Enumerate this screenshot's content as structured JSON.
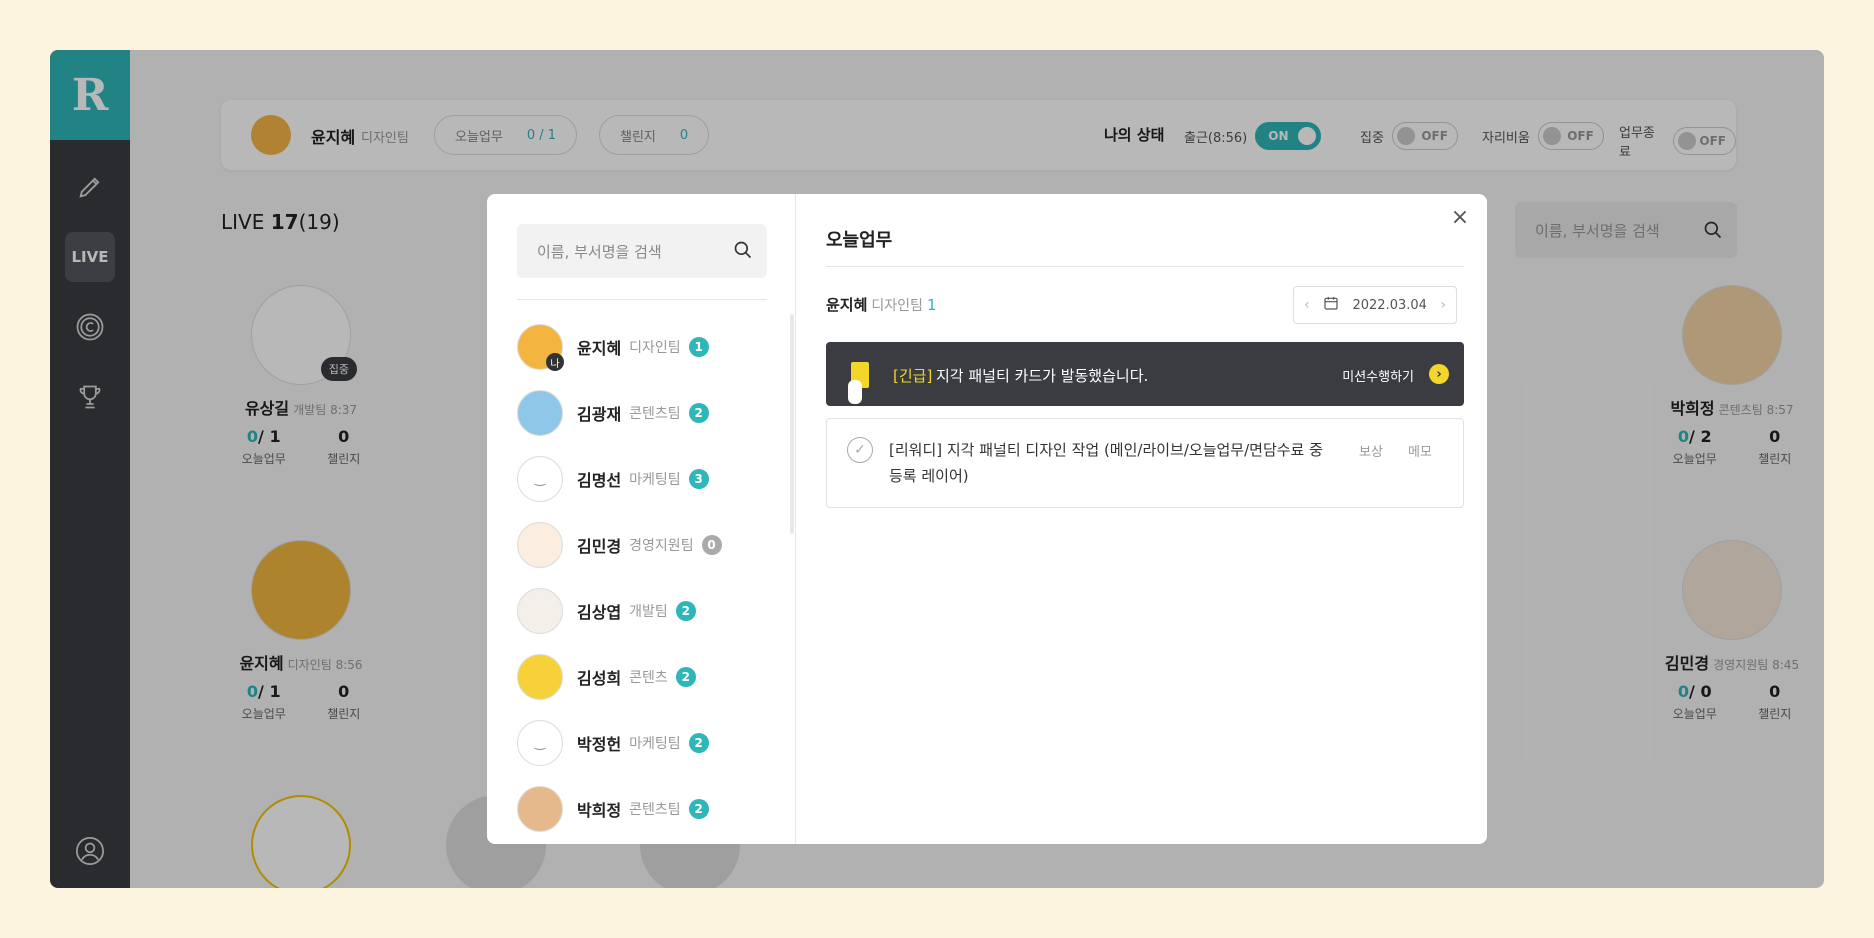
{
  "sidebar": {
    "logo": "R",
    "live_label": "LIVE"
  },
  "topbar": {
    "name": "윤지혜",
    "team": "디자인팀",
    "today_label": "오늘업무",
    "today_value": "0 / 1",
    "challenge_label": "챌린지",
    "challenge_value": "0",
    "status_label": "나의 상태",
    "toggles": [
      {
        "label": "출근(8:56)",
        "state": "ON"
      },
      {
        "label": "집중",
        "state": "OFF"
      },
      {
        "label": "자리비움",
        "state": "OFF"
      },
      {
        "label": "업무종료",
        "state": "OFF"
      }
    ]
  },
  "live": {
    "title_prefix": "LIVE",
    "count": "17",
    "total": "(19)",
    "search_placeholder": "이름, 부서명을 검색"
  },
  "cards": [
    {
      "name": "유상길",
      "team": "개발팀",
      "time": "8:37",
      "today": "0",
      "today_total": "/ 1",
      "challenge": "0",
      "badge": "집중"
    },
    {
      "name": "박희정",
      "team": "콘텐츠팀",
      "time": "8:57",
      "today": "0",
      "today_total": "/ 2",
      "challenge": "0"
    },
    {
      "name": "윤지혜",
      "team": "디자인팀",
      "time": "8:56",
      "today": "0",
      "today_total": "/ 1",
      "challenge": "0"
    },
    {
      "name": "김민경",
      "team": "경영지원팀",
      "time": "8:45",
      "today": "0",
      "today_total": "/ 0",
      "challenge": "0"
    }
  ],
  "card_labels": {
    "today": "오늘업무",
    "challenge": "챌린지"
  },
  "modal": {
    "search_placeholder": "이름, 부서명을 검색",
    "members": [
      {
        "name": "윤지혜",
        "team": "디자인팀",
        "count": "1",
        "me": "나"
      },
      {
        "name": "김광재",
        "team": "콘텐츠팀",
        "count": "2"
      },
      {
        "name": "김명선",
        "team": "마케팅팀",
        "count": "3"
      },
      {
        "name": "김민경",
        "team": "경영지원팀",
        "count": "0"
      },
      {
        "name": "김상엽",
        "team": "개발팀",
        "count": "2"
      },
      {
        "name": "김성희",
        "team": "콘텐츠",
        "count": "2"
      },
      {
        "name": "박정헌",
        "team": "마케팅팀",
        "count": "2"
      },
      {
        "name": "박희정",
        "team": "콘텐츠팀",
        "count": "2"
      }
    ],
    "title": "오늘업무",
    "user_name": "윤지혜",
    "user_team": "디자인팀",
    "user_count": "1",
    "date": "2022.03.04",
    "alert_tag": "[긴급]",
    "alert_msg": "지각 패널티 카드가 발동했습니다.",
    "alert_action": "미션수행하기",
    "task_text": "[리워디] 지각 패널티 디자인 작업 (메인/라이브/오늘업무/면담수료 중 등록 레이어)",
    "task_reward": "보상",
    "task_memo": "메모"
  }
}
